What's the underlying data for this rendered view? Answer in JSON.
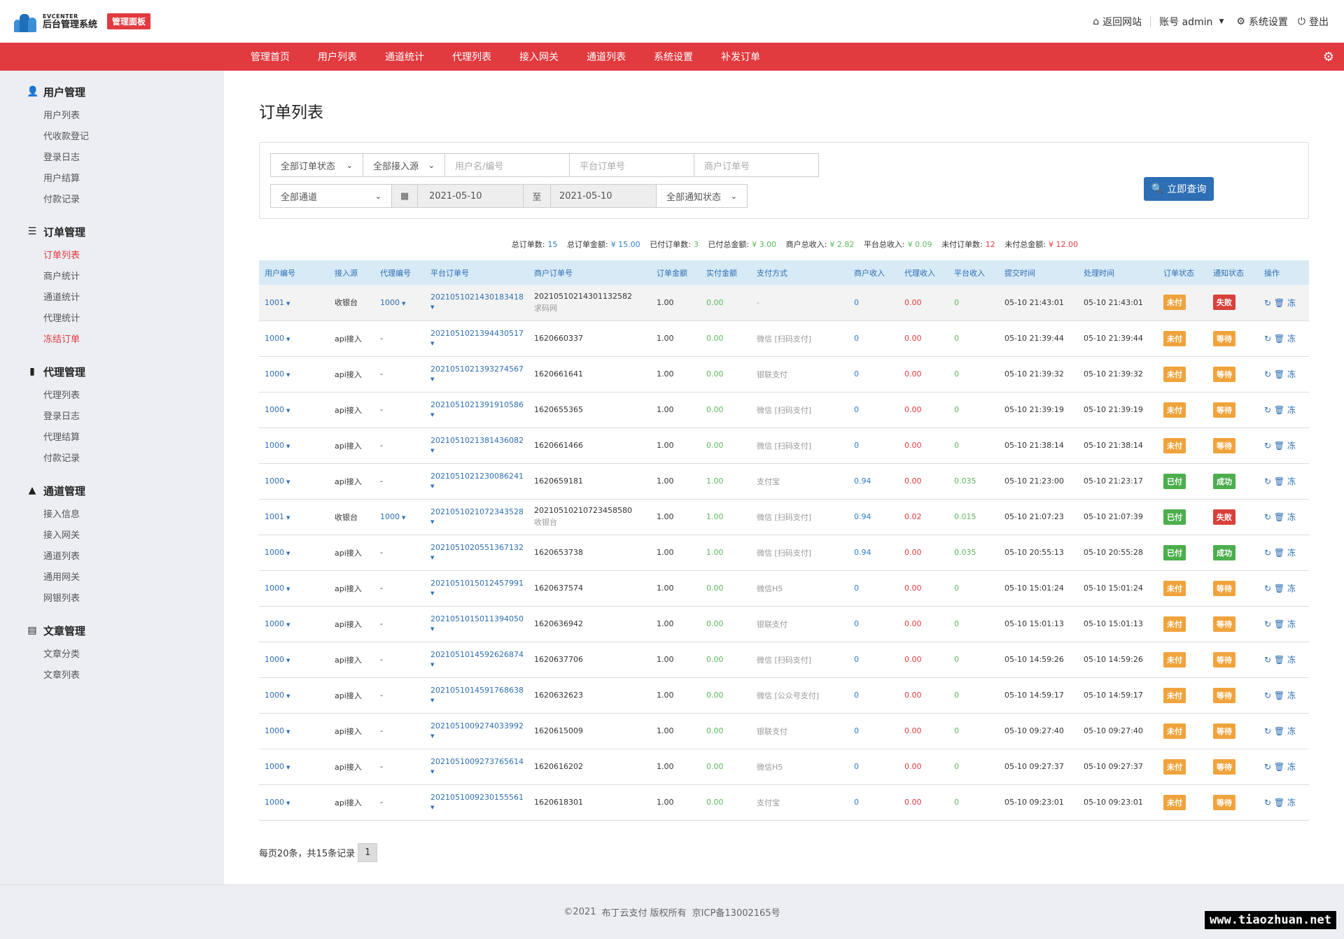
{
  "header": {
    "logo_en": "EVCENTER",
    "logo_zh": "后台管理系统",
    "panel_badge": "管理面板",
    "links": [
      {
        "icon": "home-icon",
        "label": "返回网站"
      },
      {
        "icon": "",
        "label": "账号 admin"
      },
      {
        "icon": "gear-icon",
        "label": "系统设置"
      },
      {
        "icon": "power-icon",
        "label": "登出"
      }
    ]
  },
  "nav": {
    "items": [
      "管理首页",
      "用户列表",
      "通道统计",
      "代理列表",
      "接入网关",
      "通道列表",
      "系统设置",
      "补发订单"
    ]
  },
  "sidebar": {
    "groups": [
      {
        "title": "用户管理",
        "icon": "user-icon",
        "items": [
          "用户列表",
          "代收款登记",
          "登录日志",
          "用户结算",
          "付款记录"
        ]
      },
      {
        "title": "订单管理",
        "icon": "list-icon",
        "items": [
          "订单列表",
          "商户统计",
          "通道统计",
          "代理统计",
          "冻结订单"
        ]
      },
      {
        "title": "代理管理",
        "icon": "file-icon",
        "items": [
          "代理列表",
          "登录日志",
          "代理结算",
          "付款记录"
        ]
      },
      {
        "title": "通道管理",
        "icon": "road-icon",
        "items": [
          "接入信息",
          "接入网关",
          "通道列表",
          "通用网关",
          "网银列表"
        ]
      },
      {
        "title": "文章管理",
        "icon": "newspaper-icon",
        "items": [
          "文章分类",
          "文章列表"
        ]
      }
    ]
  },
  "page": {
    "title": "订单列表",
    "filters": {
      "order_status": "全部订单状态",
      "access_source": "全部接入源",
      "user_placeholder": "用户名/编号",
      "platform_order_placeholder": "平台订单号",
      "merchant_order_placeholder": "商户订单号",
      "channel": "全部通道",
      "date_from": "2021-05-10",
      "date_to_label": "至",
      "date_to": "2021-05-10",
      "notify_status": "全部通知状态",
      "query_button": "立即查询"
    },
    "stats": {
      "total_orders_label": "总订单数:",
      "total_orders": "15",
      "total_amount_label": "总订单金额:",
      "total_amount": "¥ 15.00",
      "paid_orders_label": "已付订单数:",
      "paid_orders": "3",
      "paid_amount_label": "已付总金额:",
      "paid_amount": "¥ 3.00",
      "merchant_income_label": "商户总收入:",
      "merchant_income": "¥ 2.82",
      "platform_income_label": "平台总收入:",
      "platform_income": "¥ 0.09",
      "unpaid_orders_label": "未付订单数:",
      "unpaid_orders": "12",
      "unpaid_amount_label": "未付总金额:",
      "unpaid_amount": "¥ 12.00"
    }
  },
  "table": {
    "columns": [
      "用户编号",
      "接入源",
      "代理编号",
      "平台订单号",
      "商户订单号",
      "订单金额",
      "实付金额",
      "支付方式",
      "商户收入",
      "代理收入",
      "平台收入",
      "提交时间",
      "处理时间",
      "订单状态",
      "通知状态",
      "操作"
    ],
    "ops": {
      "refresh": "↻",
      "delete": "🗑",
      "freeze": "冻"
    },
    "rows": [
      {
        "user": "1001",
        "source": "收银台",
        "agent": "1000",
        "order_no": "2021051021430183418",
        "merchant_no": "2021051021430113258​2",
        "merchant_sub": "求码网",
        "amount": "1.00",
        "paid": "0.00",
        "method": "-",
        "m_income": "0",
        "a_income": "0.00",
        "p_income": "0",
        "submit": "05-10 21:43:01",
        "process": "05-10 21:43:01",
        "status": "未付",
        "status_type": "warn",
        "notify": "失败",
        "notify_type": "fail"
      },
      {
        "user": "1000",
        "source": "api接入",
        "agent": "-",
        "order_no": "2021051021394430517",
        "merchant_no": "1620660337",
        "merchant_sub": "",
        "amount": "1.00",
        "paid": "0.00",
        "method": "微信 [扫码支付]",
        "m_income": "0",
        "a_income": "0.00",
        "p_income": "0",
        "submit": "05-10 21:39:44",
        "process": "05-10 21:39:44",
        "status": "未付",
        "status_type": "warn",
        "notify": "等待",
        "notify_type": "warn"
      },
      {
        "user": "1000",
        "source": "api接入",
        "agent": "-",
        "order_no": "2021051021393274567",
        "merchant_no": "1620661641",
        "merchant_sub": "",
        "amount": "1.00",
        "paid": "0.00",
        "method": "银联支付",
        "m_income": "0",
        "a_income": "0.00",
        "p_income": "0",
        "submit": "05-10 21:39:32",
        "process": "05-10 21:39:32",
        "status": "未付",
        "status_type": "warn",
        "notify": "等待",
        "notify_type": "warn"
      },
      {
        "user": "1000",
        "source": "api接入",
        "agent": "-",
        "order_no": "2021051021391910586",
        "merchant_no": "1620655365",
        "merchant_sub": "",
        "amount": "1.00",
        "paid": "0.00",
        "method": "微信 [扫码支付]",
        "m_income": "0",
        "a_income": "0.00",
        "p_income": "0",
        "submit": "05-10 21:39:19",
        "process": "05-10 21:39:19",
        "status": "未付",
        "status_type": "warn",
        "notify": "等待",
        "notify_type": "warn"
      },
      {
        "user": "1000",
        "source": "api接入",
        "agent": "-",
        "order_no": "2021051021381436082",
        "merchant_no": "1620661466",
        "merchant_sub": "",
        "amount": "1.00",
        "paid": "0.00",
        "method": "微信 [扫码支付]",
        "m_income": "0",
        "a_income": "0.00",
        "p_income": "0",
        "submit": "05-10 21:38:14",
        "process": "05-10 21:38:14",
        "status": "未付",
        "status_type": "warn",
        "notify": "等待",
        "notify_type": "warn"
      },
      {
        "user": "1000",
        "source": "api接入",
        "agent": "-",
        "order_no": "2021051021230086241",
        "merchant_no": "1620659181",
        "merchant_sub": "",
        "amount": "1.00",
        "paid": "1.00",
        "method": "支付宝",
        "m_income": "0.94",
        "a_income": "0.00",
        "p_income": "0.035",
        "submit": "05-10 21:23:00",
        "process": "05-10 21:23:17",
        "status": "已付",
        "status_type": "succ",
        "notify": "成功",
        "notify_type": "succ"
      },
      {
        "user": "1001",
        "source": "收银台",
        "agent": "1000",
        "order_no": "2021051021072343528",
        "merchant_no": "2021051021072345858​0",
        "merchant_sub": "收银台",
        "amount": "1.00",
        "paid": "1.00",
        "method": "微信 [扫码支付]",
        "m_income": "0.94",
        "a_income": "0.02",
        "p_income": "0.015",
        "submit": "05-10 21:07:23",
        "process": "05-10 21:07:39",
        "status": "已付",
        "status_type": "succ",
        "notify": "失败",
        "notify_type": "fail"
      },
      {
        "user": "1000",
        "source": "api接入",
        "agent": "-",
        "order_no": "2021051020551367132",
        "merchant_no": "1620653738",
        "merchant_sub": "",
        "amount": "1.00",
        "paid": "1.00",
        "method": "微信 [扫码支付]",
        "m_income": "0.94",
        "a_income": "0.00",
        "p_income": "0.035",
        "submit": "05-10 20:55:13",
        "process": "05-10 20:55:28",
        "status": "已付",
        "status_type": "succ",
        "notify": "成功",
        "notify_type": "succ"
      },
      {
        "user": "1000",
        "source": "api接入",
        "agent": "-",
        "order_no": "2021051015012457991",
        "merchant_no": "1620637574",
        "merchant_sub": "",
        "amount": "1.00",
        "paid": "0.00",
        "method": "微信H5",
        "m_income": "0",
        "a_income": "0.00",
        "p_income": "0",
        "submit": "05-10 15:01:24",
        "process": "05-10 15:01:24",
        "status": "未付",
        "status_type": "warn",
        "notify": "等待",
        "notify_type": "warn"
      },
      {
        "user": "1000",
        "source": "api接入",
        "agent": "-",
        "order_no": "2021051015011394050",
        "merchant_no": "1620636942",
        "merchant_sub": "",
        "amount": "1.00",
        "paid": "0.00",
        "method": "银联支付",
        "m_income": "0",
        "a_income": "0.00",
        "p_income": "0",
        "submit": "05-10 15:01:13",
        "process": "05-10 15:01:13",
        "status": "未付",
        "status_type": "warn",
        "notify": "等待",
        "notify_type": "warn"
      },
      {
        "user": "1000",
        "source": "api接入",
        "agent": "-",
        "order_no": "2021051014592626874",
        "merchant_no": "1620637706",
        "merchant_sub": "",
        "amount": "1.00",
        "paid": "0.00",
        "method": "微信 [扫码支付]",
        "m_income": "0",
        "a_income": "0.00",
        "p_income": "0",
        "submit": "05-10 14:59:26",
        "process": "05-10 14:59:26",
        "status": "未付",
        "status_type": "warn",
        "notify": "等待",
        "notify_type": "warn"
      },
      {
        "user": "1000",
        "source": "api接入",
        "agent": "-",
        "order_no": "2021051014591768638",
        "merchant_no": "1620632623",
        "merchant_sub": "",
        "amount": "1.00",
        "paid": "0.00",
        "method": "微信 [公众号支付]",
        "m_income": "0",
        "a_income": "0.00",
        "p_income": "0",
        "submit": "05-10 14:59:17",
        "process": "05-10 14:59:17",
        "status": "未付",
        "status_type": "warn",
        "notify": "等待",
        "notify_type": "warn"
      },
      {
        "user": "1000",
        "source": "api接入",
        "agent": "-",
        "order_no": "2021051009274033992",
        "merchant_no": "1620615009",
        "merchant_sub": "",
        "amount": "1.00",
        "paid": "0.00",
        "method": "银联支付",
        "m_income": "0",
        "a_income": "0.00",
        "p_income": "0",
        "submit": "05-10 09:27:40",
        "process": "05-10 09:27:40",
        "status": "未付",
        "status_type": "warn",
        "notify": "等待",
        "notify_type": "warn"
      },
      {
        "user": "1000",
        "source": "api接入",
        "agent": "-",
        "order_no": "2021051009273765614",
        "merchant_no": "1620616202",
        "merchant_sub": "",
        "amount": "1.00",
        "paid": "0.00",
        "method": "微信H5",
        "m_income": "0",
        "a_income": "0.00",
        "p_income": "0",
        "submit": "05-10 09:27:37",
        "process": "05-10 09:27:37",
        "status": "未付",
        "status_type": "warn",
        "notify": "等待",
        "notify_type": "warn"
      },
      {
        "user": "1000",
        "source": "api接入",
        "agent": "-",
        "order_no": "2021051009230155561",
        "merchant_no": "1620618301",
        "merchant_sub": "",
        "amount": "1.00",
        "paid": "0.00",
        "method": "支付宝",
        "m_income": "0",
        "a_income": "0.00",
        "p_income": "0",
        "submit": "05-10 09:23:01",
        "process": "05-10 09:23:01",
        "status": "未付",
        "status_type": "warn",
        "notify": "等待",
        "notify_type": "warn"
      }
    ]
  },
  "pagination": {
    "summary": "每页20条，共15条记录",
    "current": "1"
  },
  "footer": {
    "copyright": "©2021",
    "company": "布丁云支付 版权所有",
    "icp": "京ICP备13002165号"
  },
  "watermark": "www.tiaozhuan.net",
  "colors": {
    "brand_red": "#e13a3f",
    "link_blue": "#2d6eb4",
    "warn": "#f0a33c",
    "success": "#4cae4c",
    "fail": "#d9403a"
  }
}
